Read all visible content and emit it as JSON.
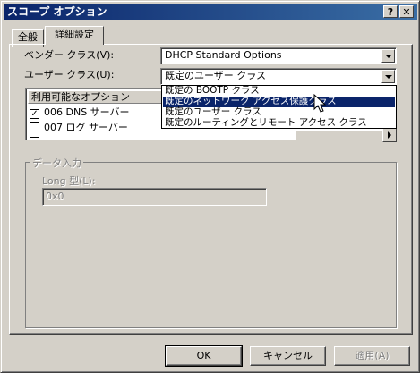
{
  "window": {
    "title": "スコープ オプション"
  },
  "titlebar": {
    "help_label": "?",
    "close_label": "✕"
  },
  "tabs": [
    {
      "label": "全般",
      "active": false
    },
    {
      "label": "詳細設定",
      "active": true
    }
  ],
  "vendor_class": {
    "label": "ベンダー クラス(V):",
    "value": "DHCP Standard Options"
  },
  "user_class": {
    "label": "ユーザー クラス(U):",
    "value": "既定のユーザー クラス",
    "options": [
      "既定の BOOTP クラス",
      "既定のネットワーク アクセス保護クラス",
      "既定のユーザー クラス",
      "既定のルーティングとリモート アクセス クラス"
    ],
    "highlighted_option": "既定のネットワーク アクセス保護クラス"
  },
  "options_list": {
    "header": "利用可能なオプション",
    "rows": [
      {
        "label": "006 DNS サーバー",
        "checked": true
      },
      {
        "label": "007 ログ サーバー",
        "checked": false
      }
    ]
  },
  "data_entry": {
    "title": "データ入力",
    "field_label": "Long 型(L):",
    "field_value": "0x0"
  },
  "buttons": {
    "ok": "OK",
    "cancel": "キャンセル",
    "apply": "適用(A)"
  },
  "colors": {
    "titlebar": "#0a246a",
    "face": "#d4d0c8",
    "selection": "#0a246a"
  },
  "icons": [
    "help-icon",
    "close-icon",
    "chevron-down-icon",
    "checkbox-icon",
    "mouse-pointer-icon"
  ]
}
